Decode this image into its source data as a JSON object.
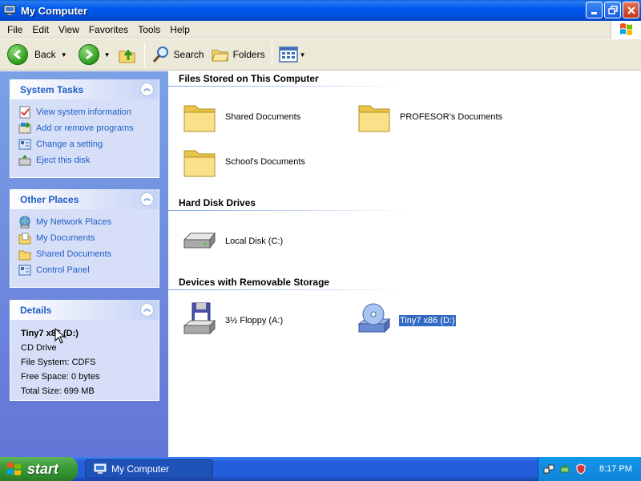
{
  "window": {
    "title": "My Computer",
    "title_icon": "my-computer-icon"
  },
  "menu": [
    "File",
    "Edit",
    "View",
    "Favorites",
    "Tools",
    "Help"
  ],
  "toolbar": {
    "back_label": "Back",
    "search_label": "Search",
    "folders_label": "Folders"
  },
  "sidebar": {
    "system_tasks": {
      "title": "System Tasks",
      "items": [
        {
          "label": "View system information",
          "icon": "system-info-icon"
        },
        {
          "label": "Add or remove programs",
          "icon": "add-remove-programs-icon"
        },
        {
          "label": "Change a setting",
          "icon": "control-panel-icon"
        },
        {
          "label": "Eject this disk",
          "icon": "eject-icon"
        }
      ]
    },
    "other_places": {
      "title": "Other Places",
      "items": [
        {
          "label": "My Network Places",
          "icon": "network-places-icon"
        },
        {
          "label": "My Documents",
          "icon": "my-documents-icon"
        },
        {
          "label": "Shared Documents",
          "icon": "folder-icon"
        },
        {
          "label": "Control Panel",
          "icon": "control-panel-icon"
        }
      ]
    },
    "details": {
      "title": "Details",
      "name": "Tiny7 x86 (D:)",
      "type": "CD Drive",
      "file_system": "File System: CDFS",
      "free_space": "Free Space: 0 bytes",
      "total_size": "Total Size: 699 MB"
    }
  },
  "main": {
    "groups": [
      {
        "title": "Files Stored on This Computer",
        "items": [
          {
            "label": "Shared Documents",
            "icon": "folder-icon"
          },
          {
            "label": "PROFESOR's Documents",
            "icon": "folder-icon"
          },
          {
            "label": "School's Documents",
            "icon": "folder-icon"
          }
        ]
      },
      {
        "title": "Hard Disk Drives",
        "items": [
          {
            "label": "Local Disk (C:)",
            "icon": "hard-disk-icon"
          }
        ]
      },
      {
        "title": "Devices with Removable Storage",
        "items": [
          {
            "label": "3½ Floppy (A:)",
            "icon": "floppy-drive-icon"
          },
          {
            "label": "Tiny7 x86 (D:)",
            "icon": "cd-drive-icon",
            "selected": true
          }
        ]
      }
    ]
  },
  "taskbar": {
    "start_label": "start",
    "task_label": "My Computer",
    "clock": "8:17 PM"
  },
  "colors": {
    "titlebar": "#0058ee",
    "sidebar_bg": "#7aa1e6",
    "task_link": "#215dc6",
    "selection": "#316ac5",
    "start_green": "#3c9b39"
  }
}
